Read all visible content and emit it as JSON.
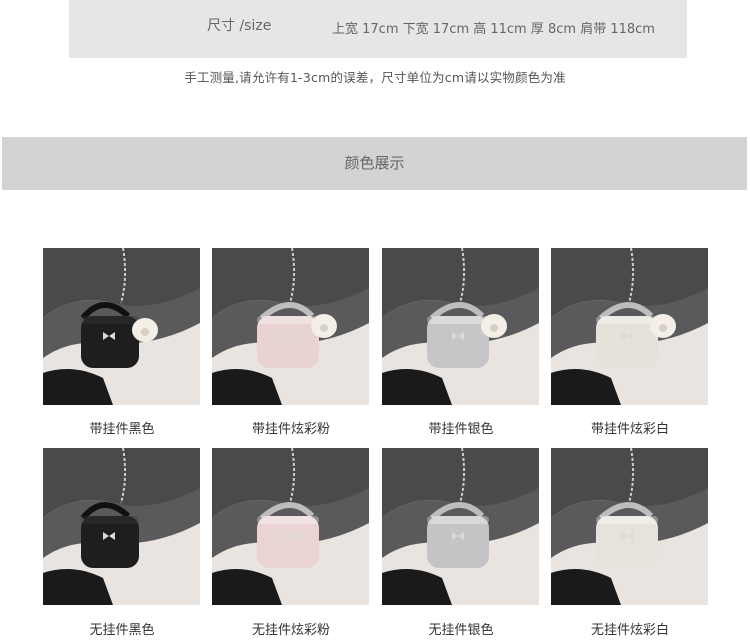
{
  "size_section": {
    "label": "尺寸 /size",
    "values": "上宽 17cm 下宽 17cm 高 11cm 厚 8cm 肩带 118cm"
  },
  "note": "手工测量,请允许有1-3cm的误差，尺寸单位为cm请以实物颜色为准",
  "colors_section": {
    "title": "颜色展示"
  },
  "products": [
    {
      "caption": "带挂件黑色",
      "bag_color": "#1e1e1e",
      "charm": true
    },
    {
      "caption": "带挂件炫彩粉",
      "bag_color": "#e9d2d2",
      "charm": true
    },
    {
      "caption": "带挂件银色",
      "bag_color": "#c6c6c8",
      "charm": true
    },
    {
      "caption": "带挂件炫彩白",
      "bag_color": "#e6e2da",
      "charm": true
    },
    {
      "caption": "无挂件黑色",
      "bag_color": "#1e1e1e",
      "charm": false
    },
    {
      "caption": "无挂件炫彩粉",
      "bag_color": "#ead4d4",
      "charm": false
    },
    {
      "caption": "无挂件银色",
      "bag_color": "#c4c4c6",
      "charm": false
    },
    {
      "caption": "无挂件炫彩白",
      "bag_color": "#e7e3dc",
      "charm": false
    }
  ]
}
